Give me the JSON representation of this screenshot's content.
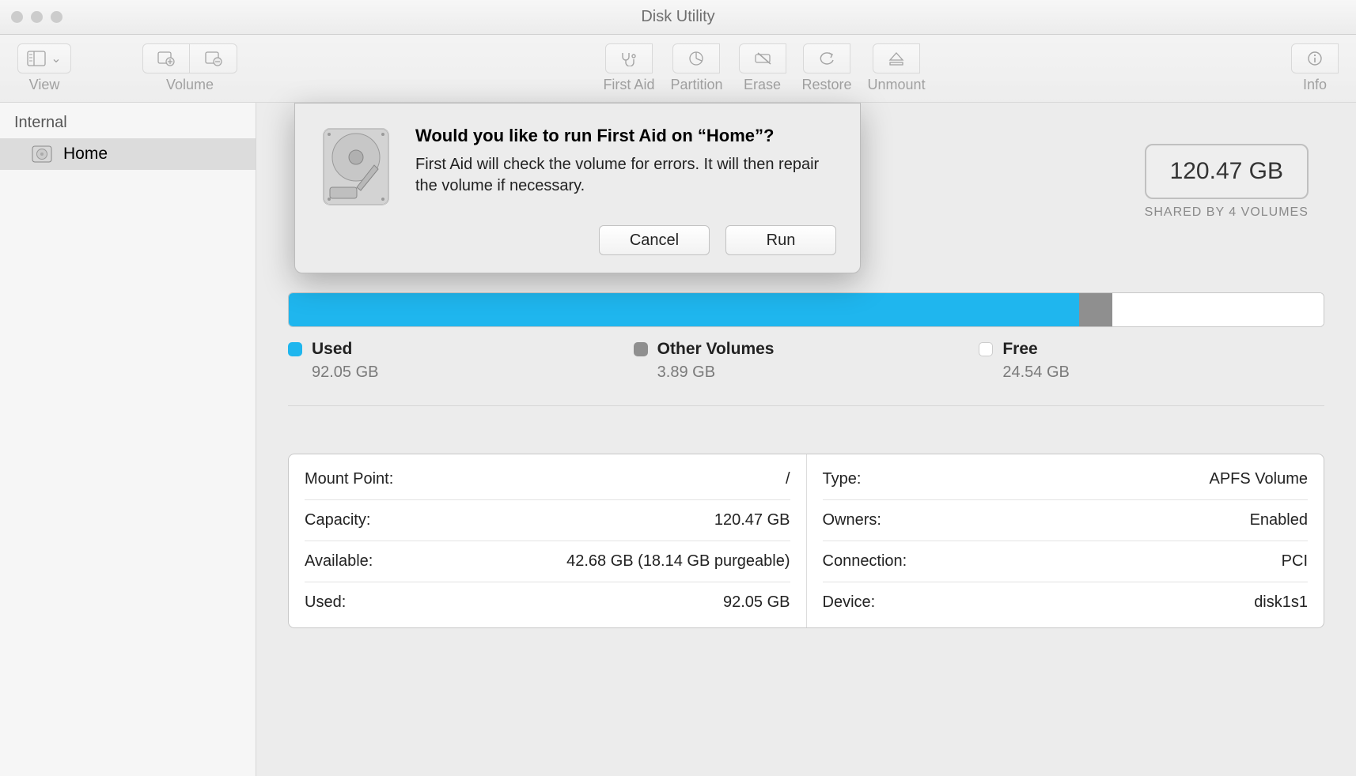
{
  "window": {
    "title": "Disk Utility"
  },
  "toolbar": {
    "view": "View",
    "volume": "Volume",
    "first_aid": "First Aid",
    "partition": "Partition",
    "erase": "Erase",
    "restore": "Restore",
    "unmount": "Unmount",
    "info": "Info"
  },
  "sidebar": {
    "internal_header": "Internal",
    "items": [
      {
        "name": "Home"
      }
    ]
  },
  "capacity": {
    "total": "120.47 GB",
    "shared_text": "SHARED BY 4 VOLUMES"
  },
  "usage": {
    "segments": [
      {
        "label": "Used",
        "value": "92.05 GB",
        "color": "#1fb6ee",
        "percent": 76.4
      },
      {
        "label": "Other Volumes",
        "value": "3.89 GB",
        "color": "#8f8f8f",
        "percent": 3.2
      },
      {
        "label": "Free",
        "value": "24.54 GB",
        "color": "#ffffff",
        "percent": 20.4
      }
    ]
  },
  "details": {
    "left": [
      {
        "label": "Mount Point:",
        "value": "/"
      },
      {
        "label": "Capacity:",
        "value": "120.47 GB"
      },
      {
        "label": "Available:",
        "value": "42.68 GB (18.14 GB purgeable)"
      },
      {
        "label": "Used:",
        "value": "92.05 GB"
      }
    ],
    "right": [
      {
        "label": "Type:",
        "value": "APFS Volume"
      },
      {
        "label": "Owners:",
        "value": "Enabled"
      },
      {
        "label": "Connection:",
        "value": "PCI"
      },
      {
        "label": "Device:",
        "value": "disk1s1"
      }
    ]
  },
  "dialog": {
    "title": "Would you like to run First Aid on “Home”?",
    "text": "First Aid will check the volume for errors. It will then repair the volume if necessary.",
    "cancel": "Cancel",
    "run": "Run"
  }
}
